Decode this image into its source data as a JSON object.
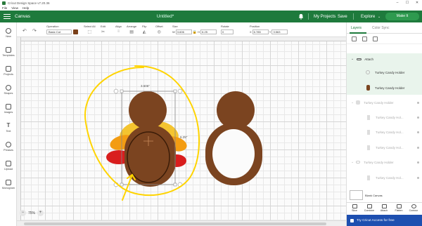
{
  "window": {
    "title": "Cricut Design Space  v7.20.36",
    "menu": [
      "File",
      "View",
      "Help"
    ],
    "controls": [
      "–",
      "☐",
      "✕"
    ]
  },
  "header": {
    "section": "Canvas",
    "document_title": "Untitled*",
    "my_projects": "My Projects",
    "save": "Save",
    "explore": "Explore",
    "make_it": "Make It"
  },
  "toolbar": {
    "operation_label": "Operation",
    "operation_value": "Basic Cut",
    "operation_color": "#7a4019",
    "select_all": "Select All",
    "edit": "Edit",
    "align": "Align",
    "arrange": "Arrange",
    "flip": "Flip",
    "offset": "Offset",
    "size_label": "Size",
    "w_label": "W",
    "w_value": "3.606",
    "h_label": "H",
    "h_value": "6.25",
    "rotate_label": "Rotate",
    "rotate_value": "0",
    "position_label": "Position",
    "x_label": "X",
    "x_value": "6.785",
    "y_label": "Y",
    "y_value": "3.563"
  },
  "leftbar": [
    {
      "label": "New",
      "icon": "plus-icon"
    },
    {
      "label": "Templates",
      "icon": "shirt-icon"
    },
    {
      "label": "Projects",
      "icon": "projects-icon"
    },
    {
      "label": "Shapes",
      "icon": "shapes-icon"
    },
    {
      "label": "Images",
      "icon": "image-icon"
    },
    {
      "label": "Text",
      "icon": "text-icon"
    },
    {
      "label": "Phrases",
      "icon": "phrases-icon"
    },
    {
      "label": "Upload",
      "icon": "upload-icon"
    },
    {
      "label": "Monogram",
      "icon": "monogram-icon"
    }
  ],
  "canvas": {
    "width_label": "3.606\"",
    "height_label": "6.25\"",
    "zoom": "75%",
    "colors": {
      "brown": "#7b4420",
      "dark_brown": "#5a2f12",
      "orange": "#f39c12",
      "yellow": "#f4c430",
      "red": "#d91e1e",
      "annotation": "#ffd400"
    }
  },
  "panel": {
    "tab_layers": "Layers",
    "tab_color_sync": "Color Sync",
    "attach": "Attach",
    "layers": [
      {
        "name": "Turkey Candy Holder",
        "dim": false
      },
      {
        "name": "Turkey Candy Holder",
        "dim": false
      },
      {
        "name": "Turkey Candy Holder",
        "dim": true
      },
      {
        "name": "Turkey Candy Hol...",
        "dim": true
      },
      {
        "name": "Turkey Candy Hol...",
        "dim": true
      },
      {
        "name": "Turkey Candy Hol...",
        "dim": true
      },
      {
        "name": "Turkey Candy Holder",
        "dim": true
      },
      {
        "name": "Turkey Candy Hol...",
        "dim": true
      }
    ],
    "blank_canvas": "Blank Canvas",
    "actions": [
      "Slice",
      "Combine",
      "Attach",
      "Flatten",
      "Contour"
    ],
    "access_promo": "Try Cricut Access for free"
  }
}
